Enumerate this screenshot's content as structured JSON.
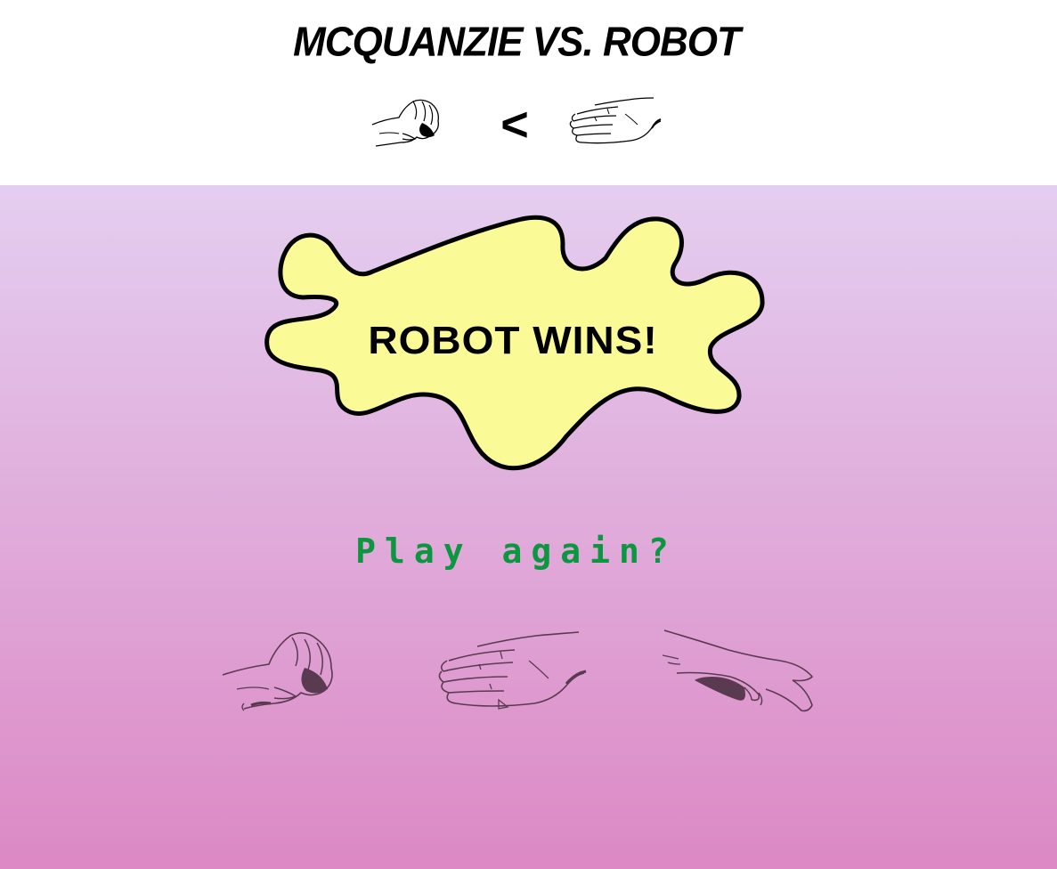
{
  "header": {
    "title": "MCQUANZIE VS. ROBOT",
    "player_choice_icon": "rock-hand-icon",
    "comparator": "<",
    "robot_choice_icon": "paper-hand-icon"
  },
  "result": {
    "message": "ROBOT WINS!",
    "splat_fill": "#fafa96",
    "splat_stroke": "#000000"
  },
  "play_again": {
    "label": "Play again?",
    "color": "#0b9640"
  },
  "choices": [
    {
      "name": "rock",
      "icon": "rock-hand-icon"
    },
    {
      "name": "paper",
      "icon": "paper-hand-icon"
    },
    {
      "name": "scissors",
      "icon": "scissors-hand-icon"
    }
  ],
  "theme": {
    "gradient_top": "#e4cef0",
    "gradient_bottom": "#dc88c4",
    "hand_color": "#5a3a50"
  }
}
